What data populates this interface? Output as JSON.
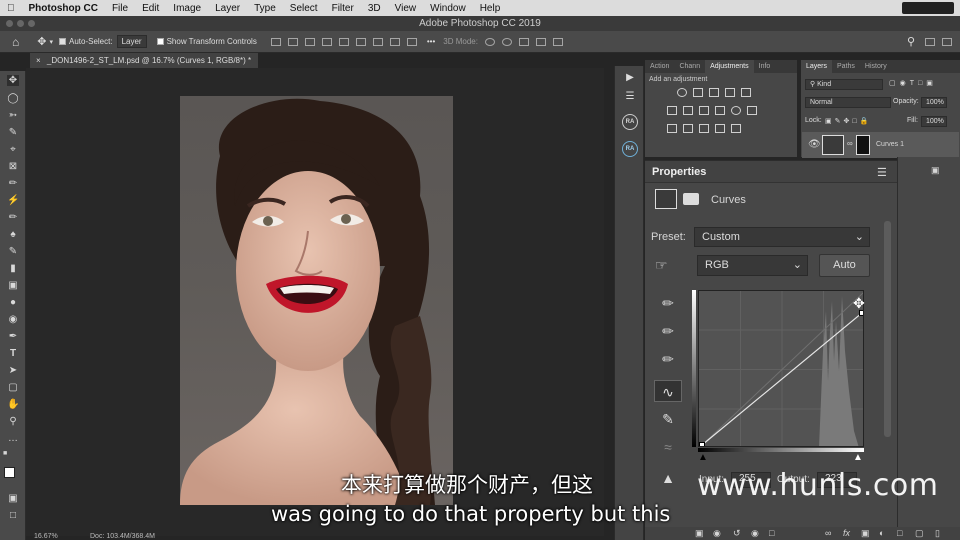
{
  "menubar": {
    "app": "Photoshop CC",
    "items": [
      "File",
      "Edit",
      "Image",
      "Layer",
      "Type",
      "Select",
      "Filter",
      "3D",
      "View",
      "Window",
      "Help"
    ]
  },
  "window": {
    "title": "Adobe Photoshop CC 2019"
  },
  "options": {
    "auto_select_label": "Auto-Select:",
    "auto_select_value": "Layer",
    "transform_label": "Show Transform Controls",
    "mode_label": "3D Mode:"
  },
  "document": {
    "tab": "_DON1496-2_ST_LM.psd @ 16.7% (Curves 1, RGB/8*) *",
    "zoom": "16.67%",
    "doc_size": "Doc: 103.4M/368.4M"
  },
  "adjustments": {
    "tabs": [
      "Action",
      "Chann",
      "Adjustments",
      "Info"
    ],
    "active_tab": "Adjustments",
    "hint": "Add an adjustment"
  },
  "layers": {
    "tabs": [
      "Layers",
      "Paths",
      "History"
    ],
    "active_tab": "Layers",
    "kind": "Kind",
    "blend": "Normal",
    "opacity_label": "Opacity:",
    "opacity": "100%",
    "lock_label": "Lock:",
    "fill_label": "Fill:",
    "fill": "100%",
    "layer_name": "Curves 1"
  },
  "properties": {
    "title": "Properties",
    "panel_name": "Curves",
    "preset_label": "Preset:",
    "preset": "Custom",
    "channel": "RGB",
    "auto": "Auto",
    "input_label": "Input:",
    "input": "255",
    "output_label": "Output:",
    "output": "223",
    "curve_points": [
      [
        0,
        0
      ],
      [
        255,
        223
      ]
    ]
  },
  "strip": {
    "ra1": "RA",
    "ra2": "RA"
  },
  "watermark": "www.hunls.com",
  "subtitles": {
    "cn": "本来打算做那个财产，但这",
    "en": "was going to do that property but this"
  },
  "colors": {
    "panel": "#474747",
    "canvas": "#282828",
    "accent_red": "#cc2a2a"
  }
}
